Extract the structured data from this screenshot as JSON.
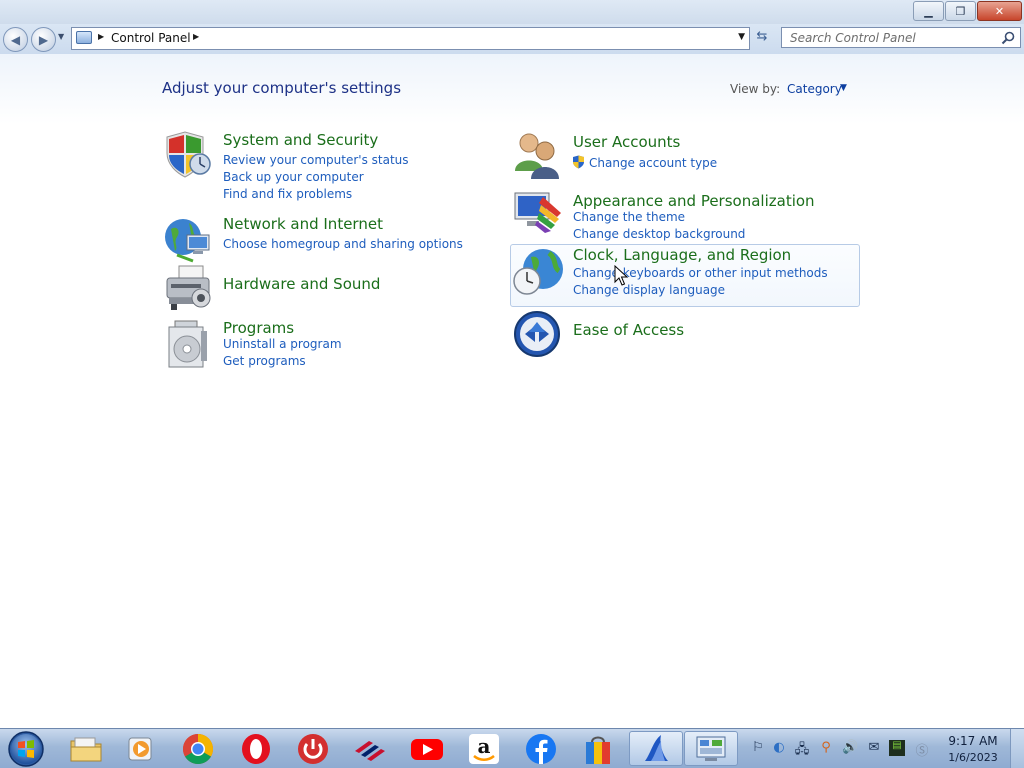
{
  "window": {
    "minimize_label": "▁",
    "maximize_label": "❐",
    "close_label": "✕"
  },
  "address": {
    "breadcrumb": "Control Panel",
    "search_placeholder": "Search Control Panel"
  },
  "content": {
    "page_title": "Adjust your computer's settings",
    "view_by_label": "View by:",
    "view_by_value": "Category",
    "categories": [
      {
        "title": "System and Security",
        "icon": "shield-icon",
        "links": [
          "Review your computer's status",
          "Back up your computer",
          "Find and fix problems"
        ]
      },
      {
        "title": "Network and Internet",
        "icon": "network-globe-icon",
        "links": [
          "Choose homegroup and sharing options"
        ]
      },
      {
        "title": "Hardware and Sound",
        "icon": "printer-icon",
        "links": []
      },
      {
        "title": "Programs",
        "icon": "programs-icon",
        "links": [
          "Uninstall a program",
          "Get programs"
        ]
      },
      {
        "title": "User Accounts",
        "icon": "users-icon",
        "links": [
          "Change account type"
        ]
      },
      {
        "title": "Appearance and Personalization",
        "icon": "monitor-palette-icon",
        "links": [
          "Change the theme",
          "Change desktop background"
        ]
      },
      {
        "title": "Clock, Language, and Region",
        "icon": "globe-clock-icon",
        "links": [
          "Change keyboards or other input methods",
          "Change display language"
        ]
      },
      {
        "title": "Ease of Access",
        "icon": "ease-of-access-icon",
        "links": []
      }
    ]
  },
  "taskbar": {
    "apps": [
      "file-explorer",
      "media-player",
      "chrome",
      "opera",
      "power",
      "bank-of-america",
      "youtube",
      "amazon",
      "facebook",
      "store",
      "shark",
      "control-panel"
    ],
    "time": "9:17 AM",
    "date": "1/6/2023"
  },
  "colors": {
    "link": "#1e5dbd",
    "category_title": "#1b6e1b",
    "page_title": "#1e3287"
  }
}
